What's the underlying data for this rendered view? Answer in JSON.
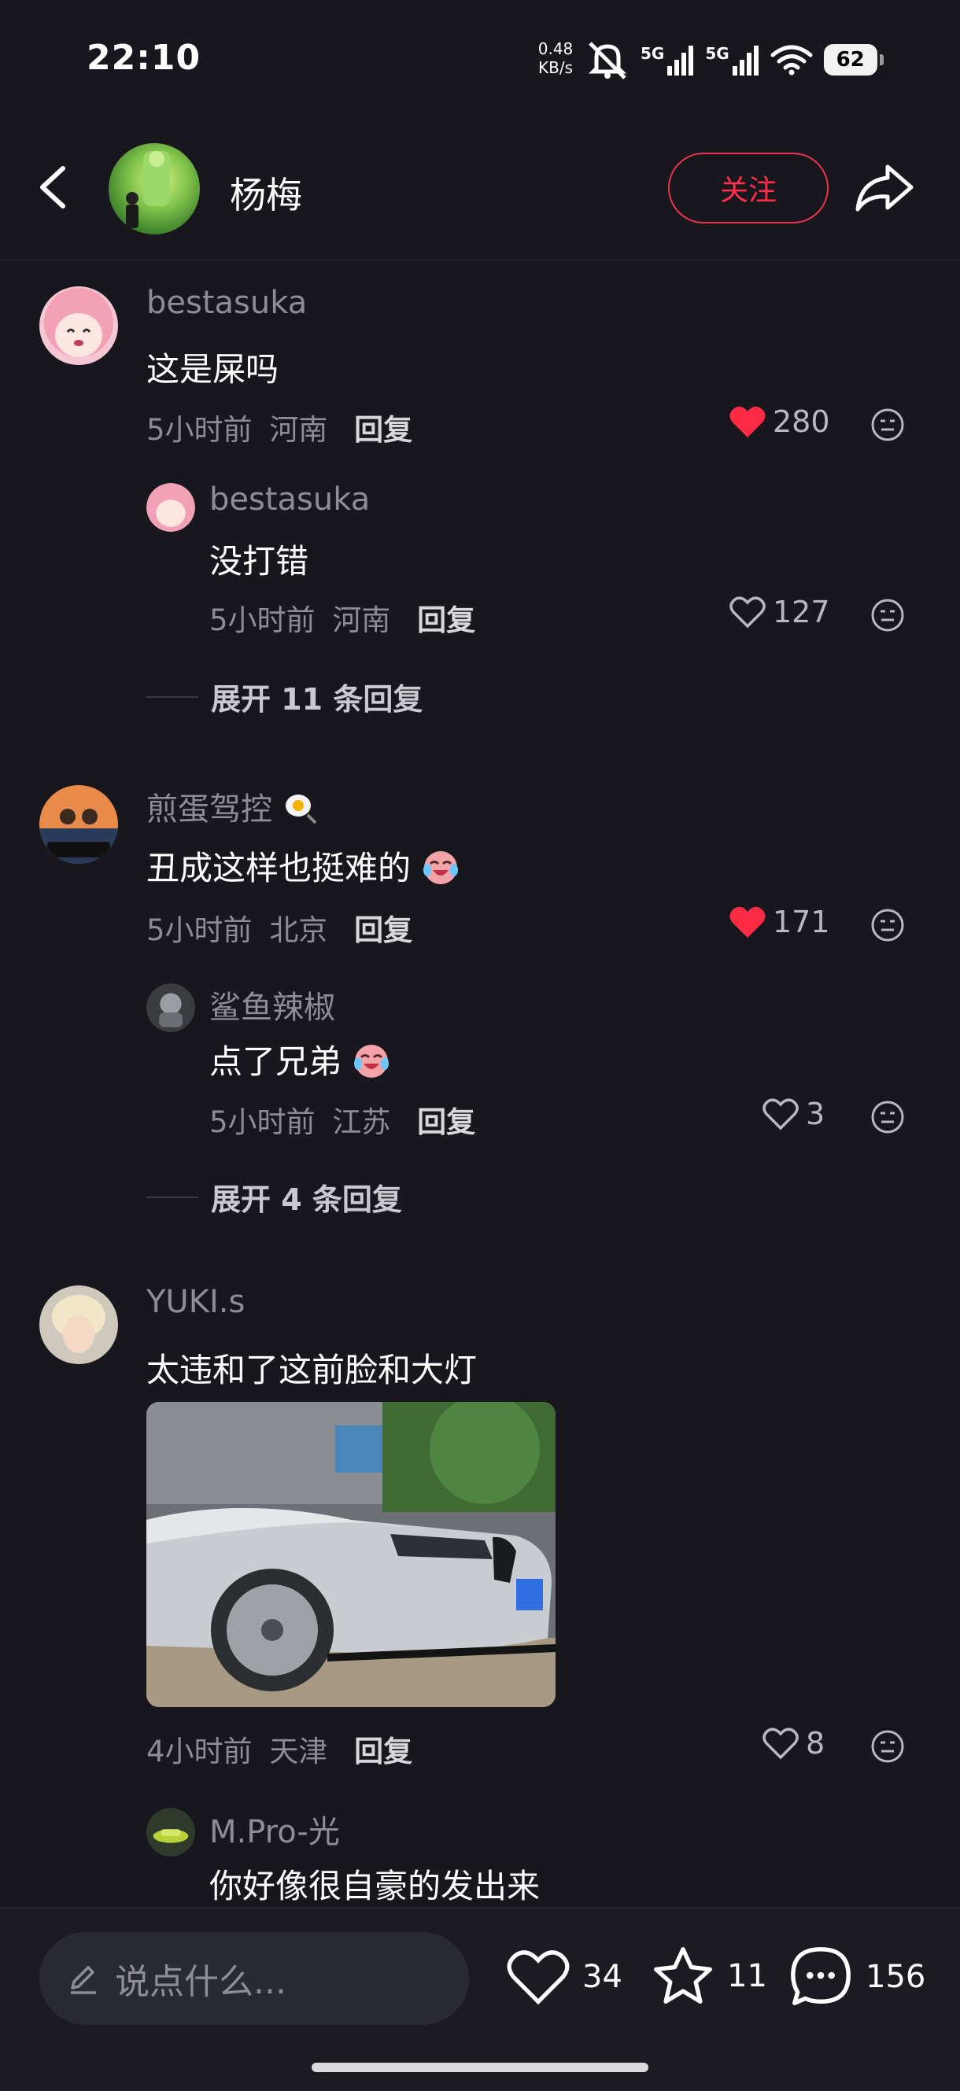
{
  "status_bar": {
    "time": "22:10",
    "net_speed_value": "0.48",
    "net_speed_unit": "KB/s",
    "network_1": "5G",
    "network_2": "5G",
    "battery": "62"
  },
  "header": {
    "author_name": "杨梅",
    "follow_label": "关注"
  },
  "comments": [
    {
      "username": "bestasuka",
      "text": "这是屎吗",
      "time": "5小时前",
      "location": "河南",
      "reply_label": "回复",
      "likes": "280",
      "liked": true,
      "replies": [
        {
          "username": "bestasuka",
          "text": "没打错",
          "time": "5小时前",
          "location": "河南",
          "reply_label": "回复",
          "likes": "127",
          "liked": false
        }
      ],
      "expand_label": "展开 11 条回复"
    },
    {
      "username": "煎蛋驾控",
      "text": "丑成这样也挺难的",
      "time": "5小时前",
      "location": "北京",
      "reply_label": "回复",
      "likes": "171",
      "liked": true,
      "replies": [
        {
          "username": "鲨鱼辣椒",
          "text": "点了兄弟",
          "time": "5小时前",
          "location": "江苏",
          "reply_label": "回复",
          "likes": "3",
          "liked": false
        }
      ],
      "expand_label": "展开 4 条回复"
    },
    {
      "username": "YUKI.s",
      "text": "太违和了这前脸和大灯",
      "time": "4小时前",
      "location": "天津",
      "reply_label": "回复",
      "likes": "8",
      "liked": false,
      "replies": [
        {
          "username": "M.Pro-光",
          "text": "你好像很自豪的发出来"
        }
      ]
    }
  ],
  "bottom_bar": {
    "input_placeholder": "说点什么...",
    "likes": "34",
    "favorites": "11",
    "comments": "156"
  },
  "colors": {
    "background": "#17171d",
    "accent_red": "#ff2f4b",
    "muted_text": "#8d8d97"
  },
  "icons": [
    "back-arrow-icon",
    "share-icon",
    "heart-icon",
    "heart-outline-icon",
    "emoji-face-icon",
    "pencil-icon",
    "star-icon",
    "comment-bubble-icon",
    "mute-icon",
    "signal-icon",
    "wifi-icon"
  ]
}
